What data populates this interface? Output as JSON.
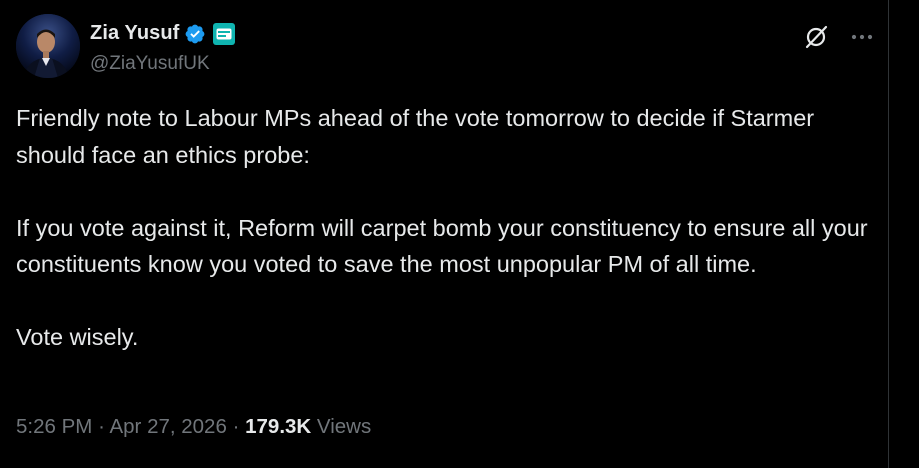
{
  "author": {
    "display_name": "Zia Yusuf",
    "handle": "@ZiaYusufUK",
    "verified": true,
    "verified_color": "#1d9bf0",
    "affiliate_badge_icon": "organization-affiliate-icon",
    "avatar_icon": "profile-photo"
  },
  "actions": {
    "grok_icon": "grok-icon",
    "more_icon": "more-horizontal-icon"
  },
  "tweet": {
    "paragraphs": [
      "Friendly note to Labour MPs ahead of the vote tomorrow to decide if Starmer should face an ethics probe:",
      "If you vote against it, Reform will carpet bomb your constituency to ensure all your constituents know you voted to save the most unpopular PM of all time.",
      "Vote wisely."
    ]
  },
  "meta": {
    "time": "5:26 PM",
    "separator": "·",
    "date": "Apr 27, 2026",
    "views_count": "179.3K",
    "views_label": "Views"
  },
  "colors": {
    "background": "#000000",
    "primary_text": "#e7e9ea",
    "secondary_text": "#71767b",
    "accent": "#1d9bf0",
    "border": "#2f3336"
  }
}
